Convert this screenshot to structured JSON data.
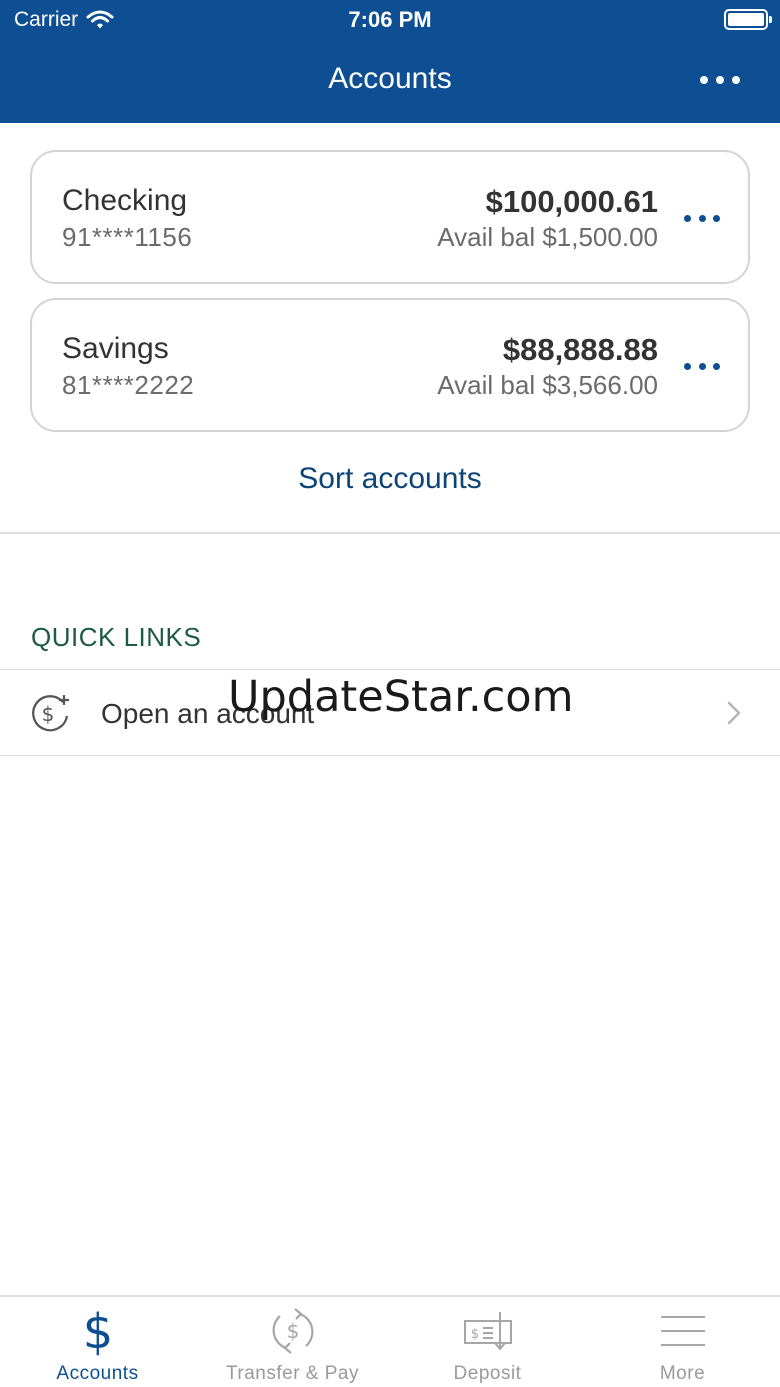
{
  "status_bar": {
    "carrier": "Carrier",
    "time": "7:06 PM"
  },
  "nav": {
    "title": "Accounts"
  },
  "accounts": [
    {
      "name": "Checking",
      "number": "91****1156",
      "balance": "$100,000.61",
      "available": "Avail bal $1,500.00"
    },
    {
      "name": "Savings",
      "number": "81****2222",
      "balance": "$88,888.88",
      "available": "Avail bal $3,566.00"
    }
  ],
  "sort_label": "Sort accounts",
  "quick_links": {
    "title": "QUICK LINKS",
    "items": [
      {
        "label": "Open an account",
        "icon": "dollar-plus-icon"
      }
    ]
  },
  "watermark": "UpdateStar.com",
  "tabs": [
    {
      "label": "Accounts",
      "icon": "dollar-icon",
      "active": true
    },
    {
      "label": "Transfer & Pay",
      "icon": "transfer-dollar-icon",
      "active": false
    },
    {
      "label": "Deposit",
      "icon": "check-deposit-icon",
      "active": false
    },
    {
      "label": "More",
      "icon": "menu-icon",
      "active": false
    }
  ],
  "colors": {
    "brand": "#0d4f92",
    "link": "#0c4478",
    "section": "#1f5a43",
    "inactive_tab": "#9a9a9a"
  }
}
